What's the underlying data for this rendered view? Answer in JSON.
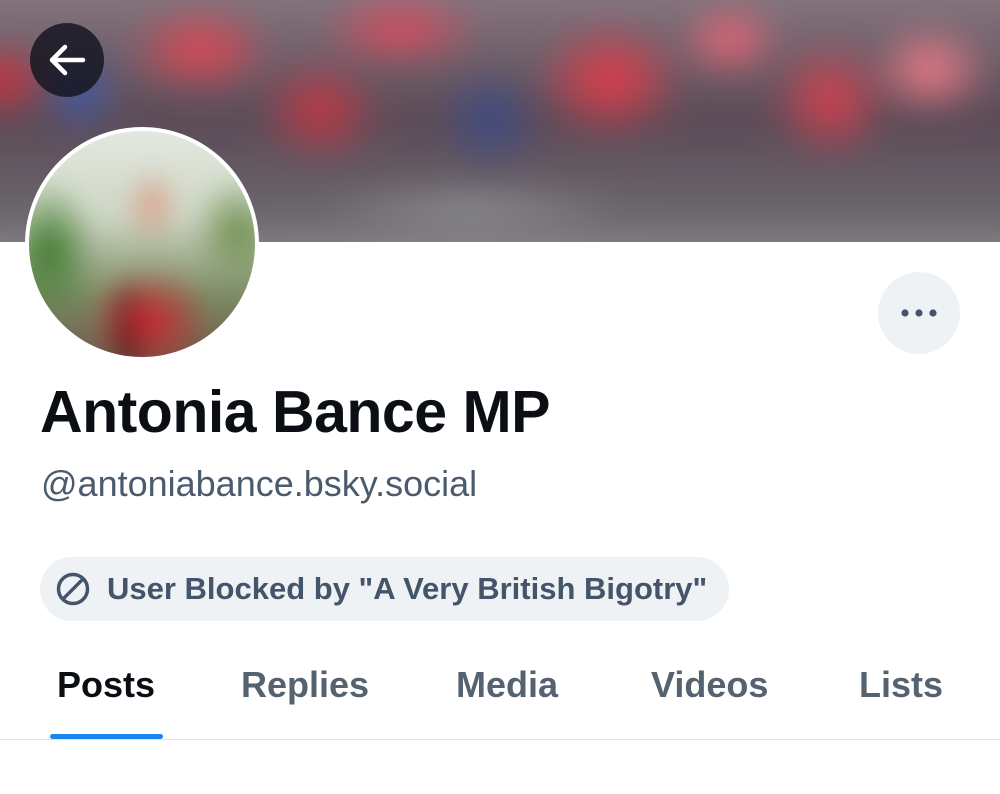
{
  "profile": {
    "display_name": "Antonia Bance MP",
    "handle": "@antoniabance.bsky.social"
  },
  "header": {
    "back_icon": "arrow-left-icon",
    "more_icon": "ellipsis-icon"
  },
  "blocked_notice": {
    "icon": "blocked-icon",
    "label": "User Blocked by \"A Very British Bigotry\""
  },
  "tabs": [
    {
      "label": "Posts",
      "active": true
    },
    {
      "label": "Replies",
      "active": false
    },
    {
      "label": "Media",
      "active": false
    },
    {
      "label": "Videos",
      "active": false
    },
    {
      "label": "Lists",
      "active": false
    }
  ],
  "colors": {
    "accent": "#1b83f2",
    "text_primary": "#0b0f14",
    "text_secondary": "#4b5b6d",
    "pill_background": "#eff2f5"
  }
}
